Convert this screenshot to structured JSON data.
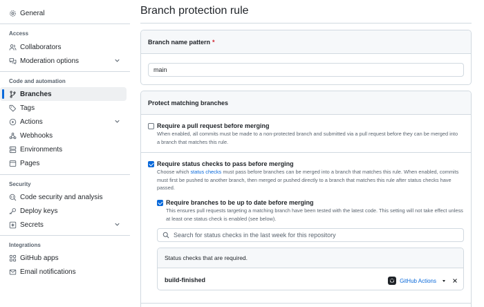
{
  "sidebar": {
    "general": "General",
    "sections": {
      "access": "Access",
      "code_automation": "Code and automation",
      "security": "Security",
      "integrations": "Integrations"
    },
    "items": {
      "collaborators": "Collaborators",
      "moderation": "Moderation options",
      "branches": "Branches",
      "tags": "Tags",
      "actions": "Actions",
      "webhooks": "Webhooks",
      "environments": "Environments",
      "pages": "Pages",
      "code_security": "Code security and analysis",
      "deploy_keys": "Deploy keys",
      "secrets": "Secrets",
      "github_apps": "GitHub apps",
      "email_notifications": "Email notifications"
    },
    "active_item": "Branches"
  },
  "main": {
    "title": "Branch protection rule",
    "branch_pattern": {
      "label": "Branch name pattern",
      "required_mark": "*",
      "value": "main"
    },
    "protect": {
      "header": "Protect matching branches",
      "pull_request": {
        "title": "Require a pull request before merging",
        "description": "When enabled, all commits must be made to a non-protected branch and submitted via a pull request before they can be merged into a branch that matches this rule.",
        "checked": false
      },
      "status_checks": {
        "title": "Require status checks to pass before merging",
        "desc_pre": "Choose which ",
        "desc_link": "status checks",
        "desc_post": " must pass before branches can be merged into a branch that matches this rule. When enabled, commits must first be pushed to another branch, then merged or pushed directly to a branch that matches this rule after status checks have passed.",
        "checked": true
      },
      "up_to_date": {
        "title": "Require branches to be up to date before merging",
        "description": "This ensures pull requests targeting a matching branch have been tested with the latest code. This setting will not take effect unless at least one status check is enabled (see below).",
        "checked": true
      },
      "search": {
        "placeholder": "Search for status checks in the last week for this repository"
      },
      "required_checks": {
        "header": "Status checks that are required.",
        "items": [
          {
            "name": "build-finished",
            "app": "GitHub Actions"
          }
        ]
      }
    }
  },
  "colors": {
    "accent": "#0969da",
    "border": "#d1d9e0",
    "muted": "#59636e"
  }
}
